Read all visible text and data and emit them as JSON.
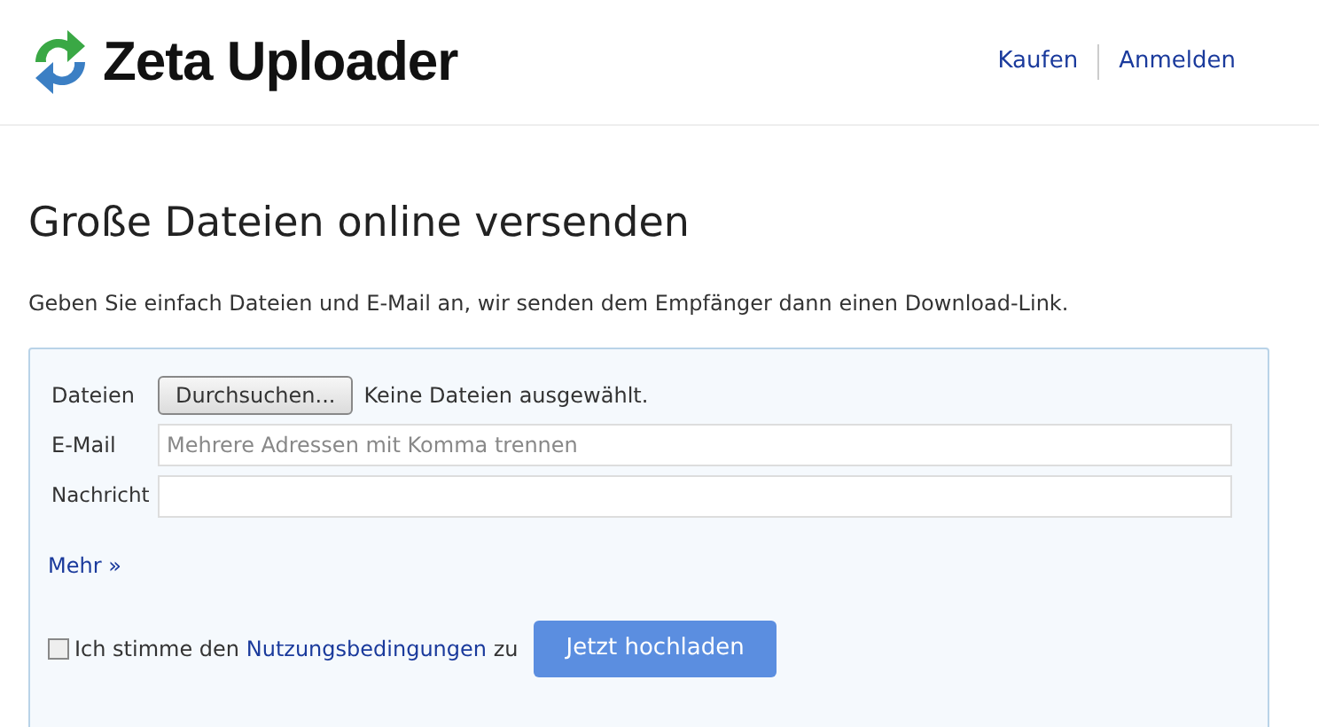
{
  "header": {
    "logo_text": "Zeta Uploader",
    "nav": [
      "Kaufen",
      "Anmelden"
    ]
  },
  "title": "Große Dateien online versenden",
  "description": "Geben Sie einfach Dateien und E-Mail an, wir senden dem Empfänger dann einen Download-Link.",
  "form": {
    "files": {
      "label": "Dateien",
      "button": "Durchsuchen...",
      "status": "Keine Dateien ausgewählt."
    },
    "email": {
      "label": "E-Mail",
      "placeholder": "Mehrere Adressen mit Komma trennen"
    },
    "message": {
      "label": "Nachricht"
    },
    "more_link": "Mehr »",
    "consent": {
      "checked": false,
      "before": "Ich stimme den",
      "link": "Nutzungsbedingungen",
      "after": "zu"
    },
    "submit": "Jetzt hochladen"
  }
}
